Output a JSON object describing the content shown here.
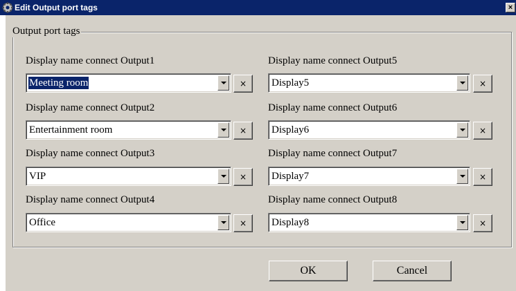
{
  "window": {
    "title": "Edit Output port tags",
    "close_label": "×"
  },
  "group": {
    "legend": "Output port tags"
  },
  "left_fields": [
    {
      "label": "Display name connect Output1",
      "value": "Meeting room",
      "selected": true
    },
    {
      "label": "Display name connect Output2",
      "value": "Entertainment room"
    },
    {
      "label": "Display name connect Output3",
      "value": "VIP"
    },
    {
      "label": "Display name connect Output4",
      "value": "Office"
    }
  ],
  "right_fields": [
    {
      "label": "Display name connect Output5",
      "value": "Display5"
    },
    {
      "label": "Display name connect Output6",
      "value": "Display6"
    },
    {
      "label": "Display name connect Output7",
      "value": "Display7"
    },
    {
      "label": "Display name connect Output8",
      "value": "Display8"
    }
  ],
  "clear_label": "×",
  "buttons": {
    "ok": "OK",
    "cancel": "Cancel"
  },
  "colors": {
    "titlebar": "#0a246a",
    "face": "#d4d0c8",
    "selection": "#0a246a"
  }
}
